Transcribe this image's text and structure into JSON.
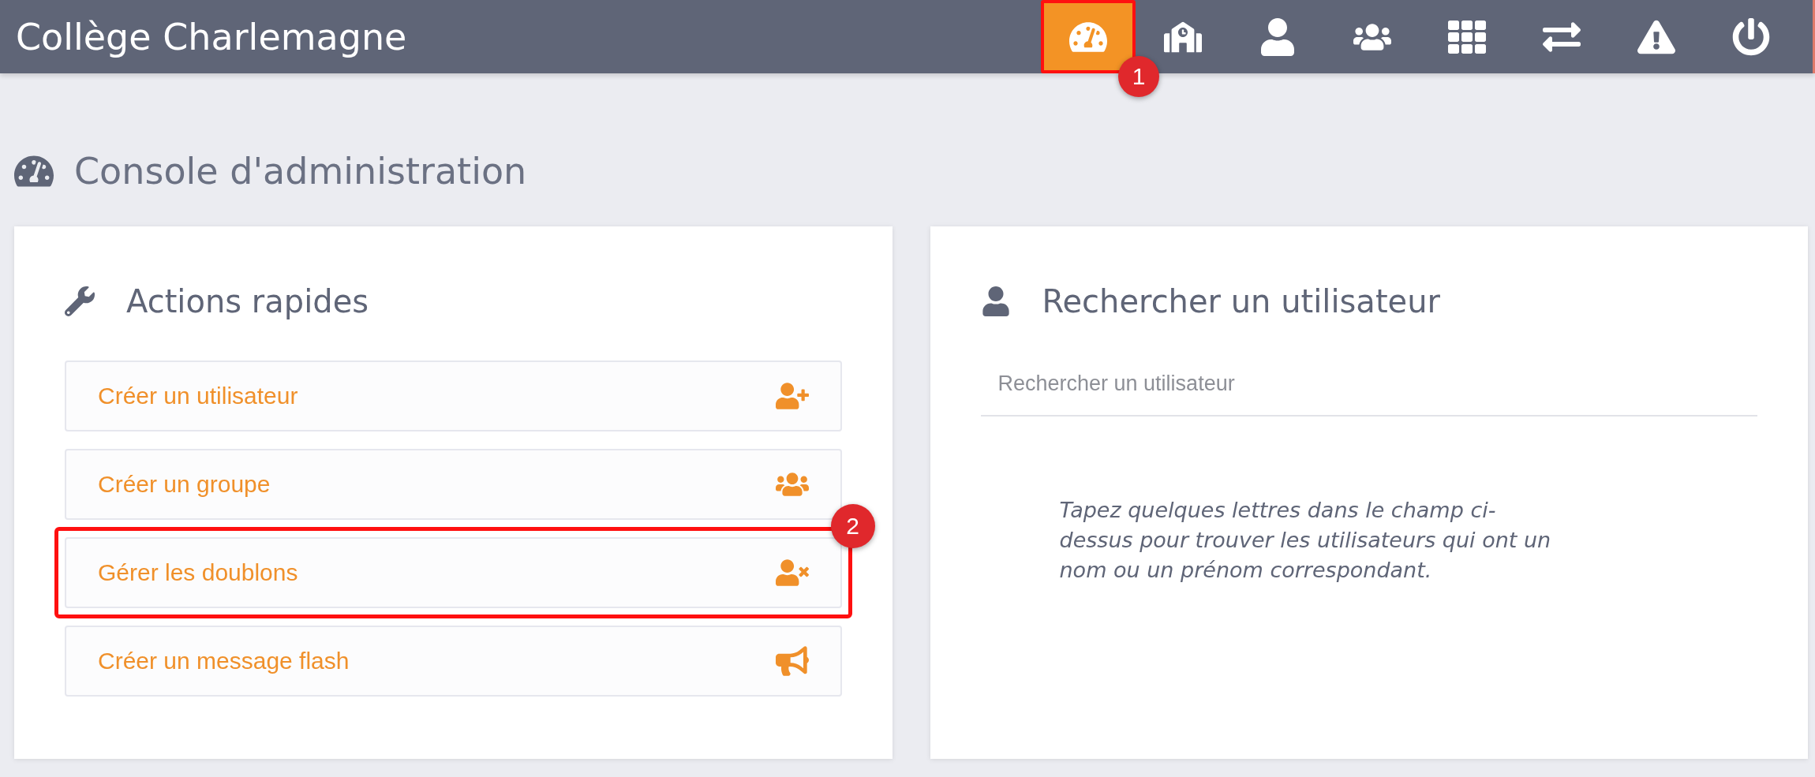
{
  "header": {
    "title": "Collège Charlemagne",
    "nav": [
      {
        "selected": true,
        "highlighted": true,
        "badge": "1"
      },
      {
        "selected": false,
        "highlighted": false
      },
      {
        "selected": false,
        "highlighted": false
      },
      {
        "selected": false,
        "highlighted": false
      },
      {
        "selected": false,
        "highlighted": false
      },
      {
        "selected": false,
        "highlighted": false
      },
      {
        "selected": false,
        "highlighted": false
      },
      {
        "selected": false,
        "highlighted": false
      }
    ]
  },
  "page_title": "Console d'administration",
  "quick_actions": {
    "title": "Actions rapides",
    "items": [
      {
        "label": "Créer un utilisateur",
        "highlighted": false
      },
      {
        "label": "Créer un groupe",
        "highlighted": false
      },
      {
        "label": "Gérer les doublons",
        "highlighted": true,
        "badge": "2"
      },
      {
        "label": "Créer un message flash",
        "highlighted": false
      }
    ]
  },
  "user_search": {
    "title": "Rechercher un utilisateur",
    "search": {
      "placeholder": "Rechercher un utilisateur"
    },
    "help": "Tapez quelques lettres dans le champ ci-dessus pour trouver les utilisateurs qui ont un nom ou un prénom correspondant."
  }
}
